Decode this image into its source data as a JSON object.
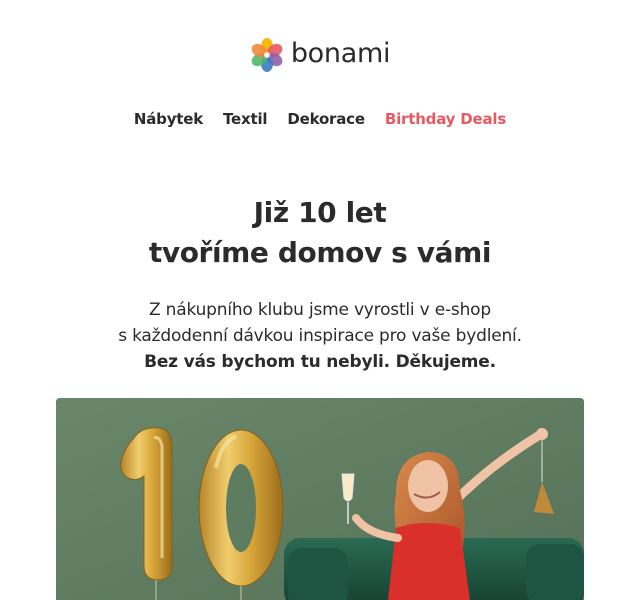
{
  "brand": {
    "name": "bonami",
    "logo_icon": "bonami-flower-logo",
    "colors": [
      "#f2b705",
      "#e85a62",
      "#8e5fa8",
      "#3b7bc0",
      "#53b66b",
      "#f08a3c"
    ]
  },
  "nav": {
    "items": [
      {
        "label": "Nábytek"
      },
      {
        "label": "Textil"
      },
      {
        "label": "Dekorace"
      },
      {
        "label": "Birthday Deals",
        "color": "#e85a62"
      }
    ]
  },
  "headline": {
    "line1": "Již 10 let",
    "line2": "tvoříme domov s vámi"
  },
  "intro": {
    "line1": "Z nákupního klubu jsme vyrostli v e-shop",
    "line2": "s každodenní dávkou inspirace pro vaše bydlení.",
    "line3": "Bez vás bychom tu nebyli. Děkujeme."
  },
  "hero": {
    "background_color": "#5f7d62",
    "balloon_text": "10",
    "balloon_color": "#d8a93c",
    "sofa_color": "#1f5a44",
    "dress_color": "#d9302c"
  }
}
